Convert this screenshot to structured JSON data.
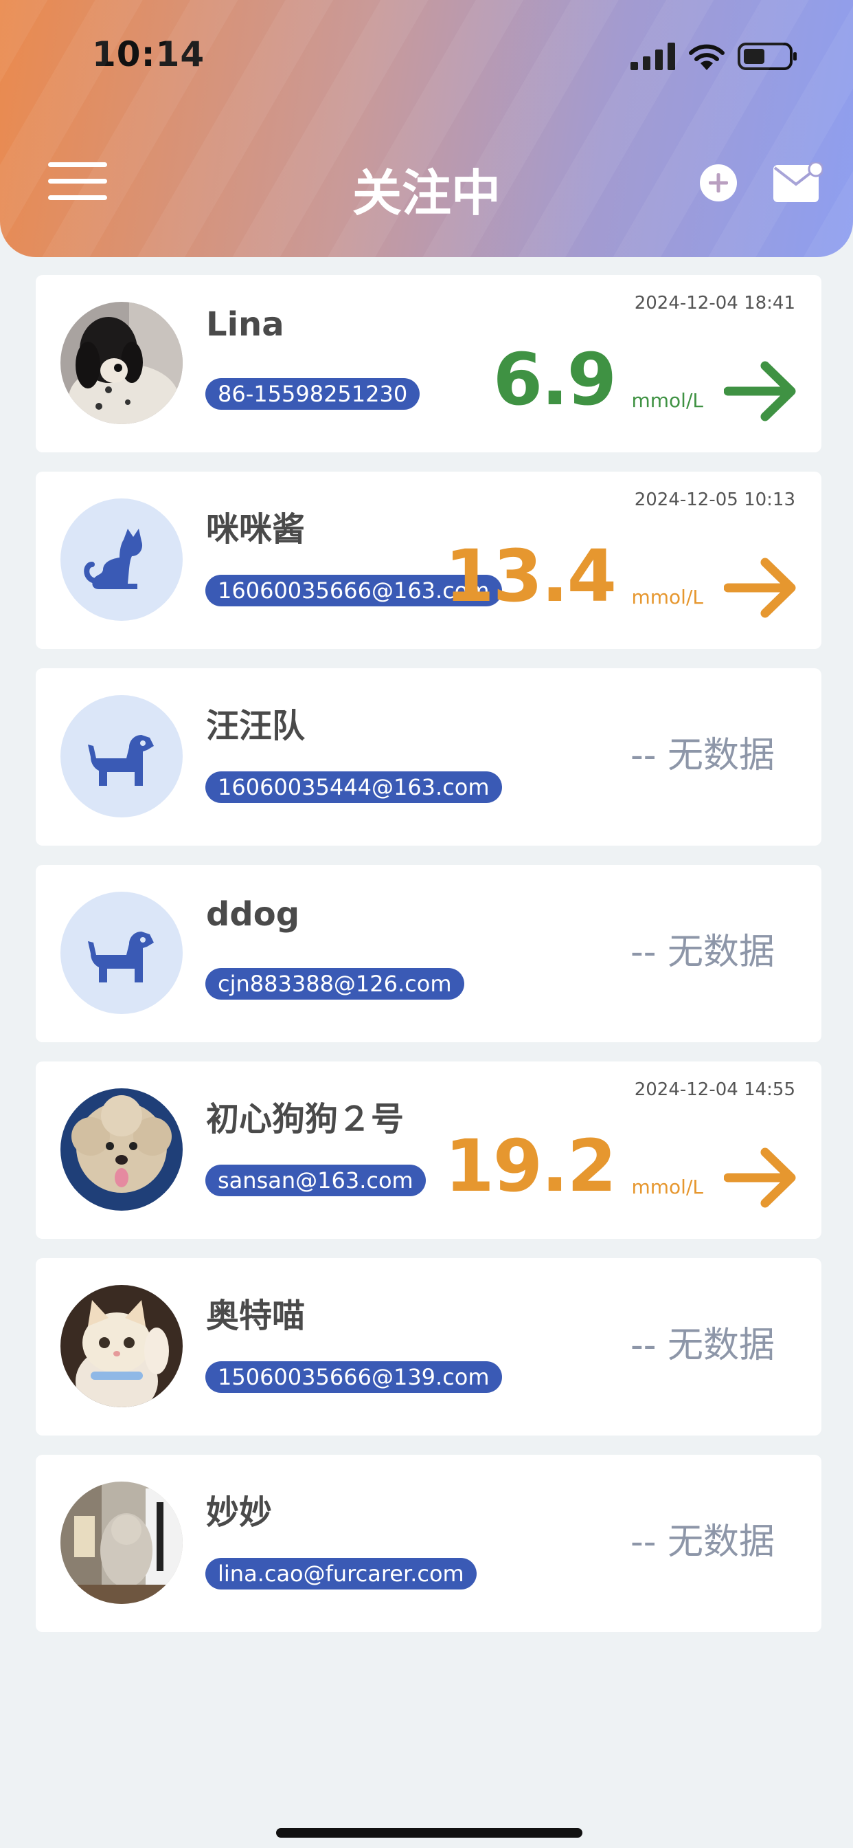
{
  "status_bar": {
    "time": "10:14"
  },
  "header": {
    "title": "关注中"
  },
  "colors": {
    "green": "#3f9243",
    "orange": "#e6972f",
    "pill": "#3a5ab5",
    "muted": "#8d96a8"
  },
  "contacts": [
    {
      "name": "Lina",
      "account": "86-15598251230",
      "timestamp": "2024-12-04 18:41",
      "value": "6.9",
      "unit": "mmol/L",
      "status": "green"
    },
    {
      "name": "咪咪酱",
      "account": "16060035666@163.com",
      "timestamp": "2024-12-05 10:13",
      "value": "13.4",
      "unit": "mmol/L",
      "status": "orange"
    },
    {
      "name": "汪汪队",
      "account": "16060035444@163.com",
      "no_data": "-- 无数据"
    },
    {
      "name": "ddog",
      "account": "cjn883388@126.com",
      "no_data": "-- 无数据"
    },
    {
      "name": "初心狗狗２号",
      "account": "sansan@163.com",
      "timestamp": "2024-12-04 14:55",
      "value": "19.2",
      "unit": "mmol/L",
      "status": "orange"
    },
    {
      "name": "奥特喵",
      "account": "15060035666@139.com",
      "no_data": "-- 无数据"
    },
    {
      "name": "妙妙",
      "account": "lina.cao@furcarer.com",
      "no_data": "-- 无数据"
    }
  ]
}
